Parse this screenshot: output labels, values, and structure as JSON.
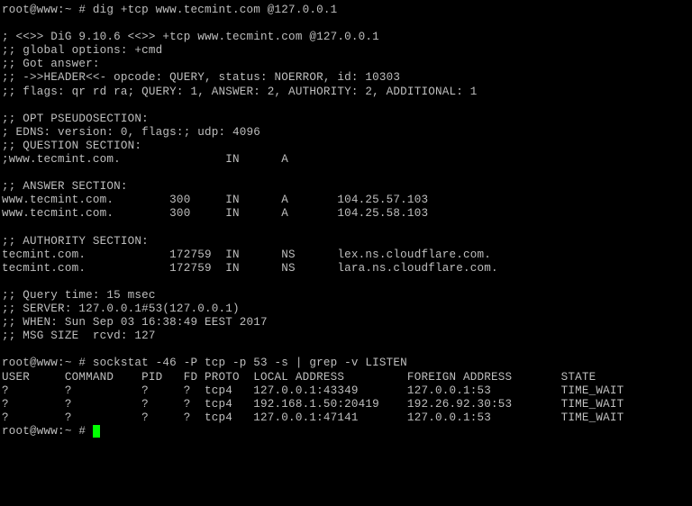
{
  "prompt1": "root@www:~ # dig +tcp www.tecmint.com @127.0.0.1",
  "blank": "",
  "dig_header": "; <<>> DiG 9.10.6 <<>> +tcp www.tecmint.com @127.0.0.1",
  "global_opts": ";; global options: +cmd",
  "got_answer": ";; Got answer:",
  "header_line": ";; ->>HEADER<<- opcode: QUERY, status: NOERROR, id: 10303",
  "flags_line": ";; flags: qr rd ra; QUERY: 1, ANSWER: 2, AUTHORITY: 2, ADDITIONAL: 1",
  "opt_pseudo": ";; OPT PSEUDOSECTION:",
  "edns_line": "; EDNS: version: 0, flags:; udp: 4096",
  "question_sec": ";; QUESTION SECTION:",
  "question_row": ";www.tecmint.com.               IN      A",
  "answer_sec": ";; ANSWER SECTION:",
  "answer_rows": [
    "www.tecmint.com.        300     IN      A       104.25.57.103",
    "www.tecmint.com.        300     IN      A       104.25.58.103"
  ],
  "authority_sec": ";; AUTHORITY SECTION:",
  "authority_rows": [
    "tecmint.com.            172759  IN      NS      lex.ns.cloudflare.com.",
    "tecmint.com.            172759  IN      NS      lara.ns.cloudflare.com."
  ],
  "query_time": ";; Query time: 15 msec",
  "server_line": ";; SERVER: 127.0.0.1#53(127.0.0.1)",
  "when_line": ";; WHEN: Sun Sep 03 16:38:49 EEST 2017",
  "msg_size": ";; MSG SIZE  rcvd: 127",
  "prompt2": "root@www:~ # sockstat -46 -P tcp -p 53 -s | grep -v LISTEN",
  "sock_header": "USER     COMMAND    PID   FD PROTO  LOCAL ADDRESS         FOREIGN ADDRESS       STATE",
  "sock_rows": [
    "?        ?          ?     ?  tcp4   127.0.0.1:43349       127.0.0.1:53          TIME_WAIT",
    "?        ?          ?     ?  tcp4   192.168.1.50:20419    192.26.92.30:53       TIME_WAIT",
    "?        ?          ?     ?  tcp4   127.0.0.1:47141       127.0.0.1:53          TIME_WAIT"
  ],
  "prompt3": "root@www:~ # "
}
